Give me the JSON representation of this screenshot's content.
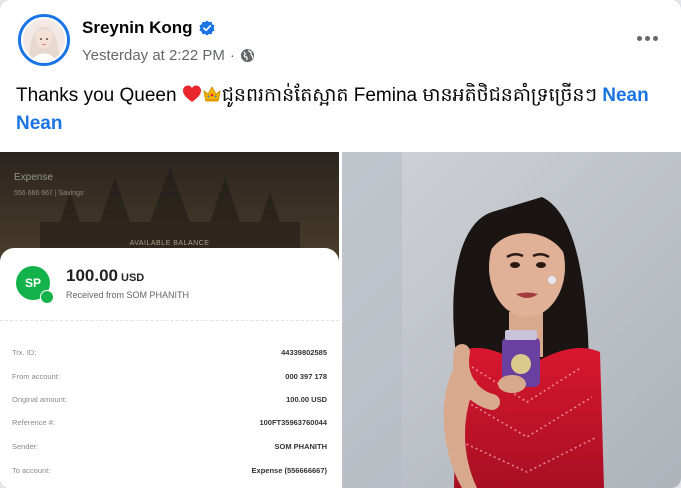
{
  "post": {
    "author": "Sreynin Kong",
    "timestamp": "Yesterday at 2:22 PM",
    "separator": "·",
    "text_before": "Thanks you Queen",
    "text_after": "ជូនពរកាន់តែស្អាត Femina មានអតិថិជនគាំទ្រច្រើនៗ",
    "mention": "Nean Nean"
  },
  "icons": {
    "verified": "verified-badge-icon",
    "audience": "globe-icon",
    "more": "more-options-icon",
    "heart": "red-heart-emoji",
    "crown": "crown-emoji"
  },
  "receipt": {
    "header_label": "Expense",
    "header_sub": "556 666 667 | Savings",
    "balance_label": "AVAILABLE BALANCE",
    "initials": "SP",
    "amount": "100.00",
    "currency": "USD",
    "received_from": "Received from SOM PHANITH",
    "details": [
      {
        "label": "Trx. ID:",
        "value": "44339802585"
      },
      {
        "label": "From account:",
        "value": "000 397 178"
      },
      {
        "label": "Original amount:",
        "value": "100.00 USD"
      },
      {
        "label": "Reference #:",
        "value": "100FT35963760044"
      },
      {
        "label": "Sender:",
        "value": "SOM PHANITH"
      },
      {
        "label": "To account:",
        "value": "Expense (556666667)"
      }
    ]
  },
  "colors": {
    "link": "#1b74e4",
    "text": "#050505",
    "secondary": "#65676b",
    "dress": "#c4122f"
  }
}
